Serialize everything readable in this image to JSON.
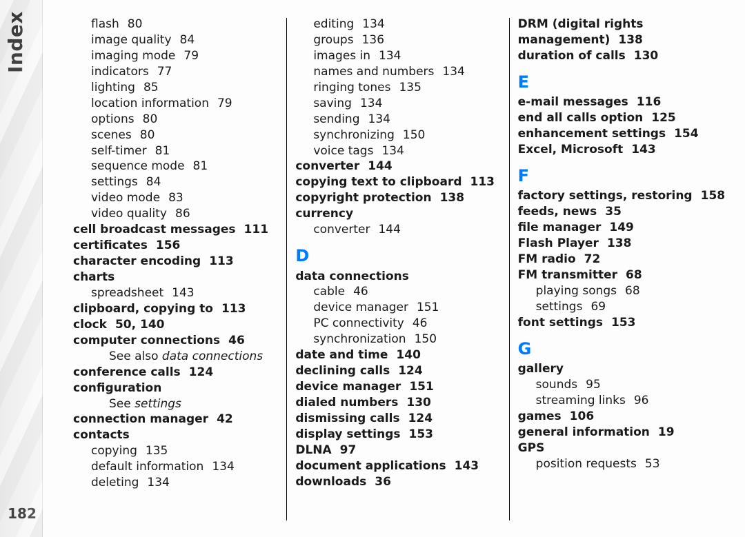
{
  "tab_title": "Index",
  "page_number": "182",
  "letters": {
    "D": "D",
    "E": "E",
    "F": "F",
    "G": "G"
  },
  "col1": [
    {
      "t": "sub",
      "label": "flash",
      "page": "80"
    },
    {
      "t": "sub",
      "label": "image quality",
      "page": "84"
    },
    {
      "t": "sub",
      "label": "imaging mode",
      "page": "79"
    },
    {
      "t": "sub",
      "label": "indicators",
      "page": "77"
    },
    {
      "t": "sub",
      "label": "lighting",
      "page": "85"
    },
    {
      "t": "sub",
      "label": "location information",
      "page": "79"
    },
    {
      "t": "sub",
      "label": "options",
      "page": "80"
    },
    {
      "t": "sub",
      "label": "scenes",
      "page": "80"
    },
    {
      "t": "sub",
      "label": "self-timer",
      "page": "81"
    },
    {
      "t": "sub",
      "label": "sequence mode",
      "page": "81"
    },
    {
      "t": "sub",
      "label": "settings",
      "page": "84"
    },
    {
      "t": "sub",
      "label": "video mode",
      "page": "83"
    },
    {
      "t": "sub",
      "label": "video quality",
      "page": "86"
    },
    {
      "t": "main",
      "label": "cell broadcast messages",
      "page": "111"
    },
    {
      "t": "main",
      "label": "certificates",
      "page": "156"
    },
    {
      "t": "main",
      "label": "character encoding",
      "page": "113"
    },
    {
      "t": "main",
      "label": "charts",
      "page": ""
    },
    {
      "t": "sub",
      "label": "spreadsheet",
      "page": "143"
    },
    {
      "t": "main",
      "label": "clipboard, copying to",
      "page": "113"
    },
    {
      "t": "main",
      "label": "clock",
      "page": "50, 140"
    },
    {
      "t": "main",
      "label": "computer connections",
      "page": "46"
    },
    {
      "t": "see",
      "prefix": "See also ",
      "label": "data connections"
    },
    {
      "t": "main",
      "label": "conference calls",
      "page": "124"
    },
    {
      "t": "main",
      "label": "configuration",
      "page": ""
    },
    {
      "t": "see",
      "prefix": "See ",
      "label": "settings"
    },
    {
      "t": "main",
      "label": "connection manager",
      "page": "42"
    },
    {
      "t": "main",
      "label": "contacts",
      "page": ""
    },
    {
      "t": "sub",
      "label": "copying",
      "page": "135"
    },
    {
      "t": "sub",
      "label": "default information",
      "page": "134"
    },
    {
      "t": "sub",
      "label": "deleting",
      "page": "134"
    }
  ],
  "col2": [
    {
      "t": "sub",
      "label": "editing",
      "page": "134"
    },
    {
      "t": "sub",
      "label": "groups",
      "page": "136"
    },
    {
      "t": "sub",
      "label": "images in",
      "page": "134"
    },
    {
      "t": "sub",
      "label": "names and numbers",
      "page": "134"
    },
    {
      "t": "sub",
      "label": "ringing tones",
      "page": "135"
    },
    {
      "t": "sub",
      "label": "saving",
      "page": "134"
    },
    {
      "t": "sub",
      "label": "sending",
      "page": "134"
    },
    {
      "t": "sub",
      "label": "synchronizing",
      "page": "150"
    },
    {
      "t": "sub",
      "label": "voice tags",
      "page": "134"
    },
    {
      "t": "main",
      "label": "converter",
      "page": "144"
    },
    {
      "t": "main",
      "label": "copying text to clipboard",
      "page": "113"
    },
    {
      "t": "main",
      "label": "copyright protection",
      "page": "138"
    },
    {
      "t": "main",
      "label": "currency",
      "page": ""
    },
    {
      "t": "sub",
      "label": "converter",
      "page": "144"
    },
    {
      "t": "letter",
      "key": "D"
    },
    {
      "t": "main",
      "label": "data connections",
      "page": ""
    },
    {
      "t": "sub",
      "label": "cable",
      "page": "46"
    },
    {
      "t": "sub",
      "label": "device manager",
      "page": "151"
    },
    {
      "t": "sub",
      "label": "PC connectivity",
      "page": "46"
    },
    {
      "t": "sub",
      "label": "synchronization",
      "page": "150"
    },
    {
      "t": "main",
      "label": "date and time",
      "page": "140"
    },
    {
      "t": "main",
      "label": "declining calls",
      "page": "124"
    },
    {
      "t": "main",
      "label": "device manager",
      "page": "151"
    },
    {
      "t": "main",
      "label": "dialed numbers",
      "page": "130"
    },
    {
      "t": "main",
      "label": "dismissing calls",
      "page": "124"
    },
    {
      "t": "main",
      "label": "display settings",
      "page": "153"
    },
    {
      "t": "main",
      "label": "DLNA",
      "page": "97"
    },
    {
      "t": "main",
      "label": "document applications",
      "page": "143"
    },
    {
      "t": "main",
      "label": "downloads",
      "page": "36"
    }
  ],
  "col3": [
    {
      "t": "main",
      "label": "DRM (digital rights management)",
      "page": "138",
      "wrap": true
    },
    {
      "t": "main",
      "label": "duration of calls",
      "page": "130"
    },
    {
      "t": "letter",
      "key": "E"
    },
    {
      "t": "main",
      "label": "e-mail messages",
      "page": "116"
    },
    {
      "t": "main",
      "label": "end all calls option",
      "page": "125"
    },
    {
      "t": "main",
      "label": "enhancement settings",
      "page": "154"
    },
    {
      "t": "main",
      "label": "Excel, Microsoft",
      "page": "143"
    },
    {
      "t": "letter",
      "key": "F"
    },
    {
      "t": "main",
      "label": "factory settings, restoring",
      "page": "158"
    },
    {
      "t": "main",
      "label": "feeds, news",
      "page": "35"
    },
    {
      "t": "main",
      "label": "file manager",
      "page": "149"
    },
    {
      "t": "main",
      "label": "Flash Player",
      "page": "138"
    },
    {
      "t": "main",
      "label": "FM radio",
      "page": "72"
    },
    {
      "t": "main",
      "label": "FM transmitter",
      "page": "68"
    },
    {
      "t": "sub",
      "label": "playing songs",
      "page": "68"
    },
    {
      "t": "sub",
      "label": "settings",
      "page": "69"
    },
    {
      "t": "main",
      "label": "font settings",
      "page": "153"
    },
    {
      "t": "letter",
      "key": "G"
    },
    {
      "t": "main",
      "label": "gallery",
      "page": ""
    },
    {
      "t": "sub",
      "label": "sounds",
      "page": "95"
    },
    {
      "t": "sub",
      "label": "streaming links",
      "page": "96"
    },
    {
      "t": "main",
      "label": "games",
      "page": "106"
    },
    {
      "t": "main",
      "label": "general information",
      "page": "19"
    },
    {
      "t": "main",
      "label": "GPS",
      "page": ""
    },
    {
      "t": "sub",
      "label": "position requests",
      "page": "53"
    }
  ]
}
